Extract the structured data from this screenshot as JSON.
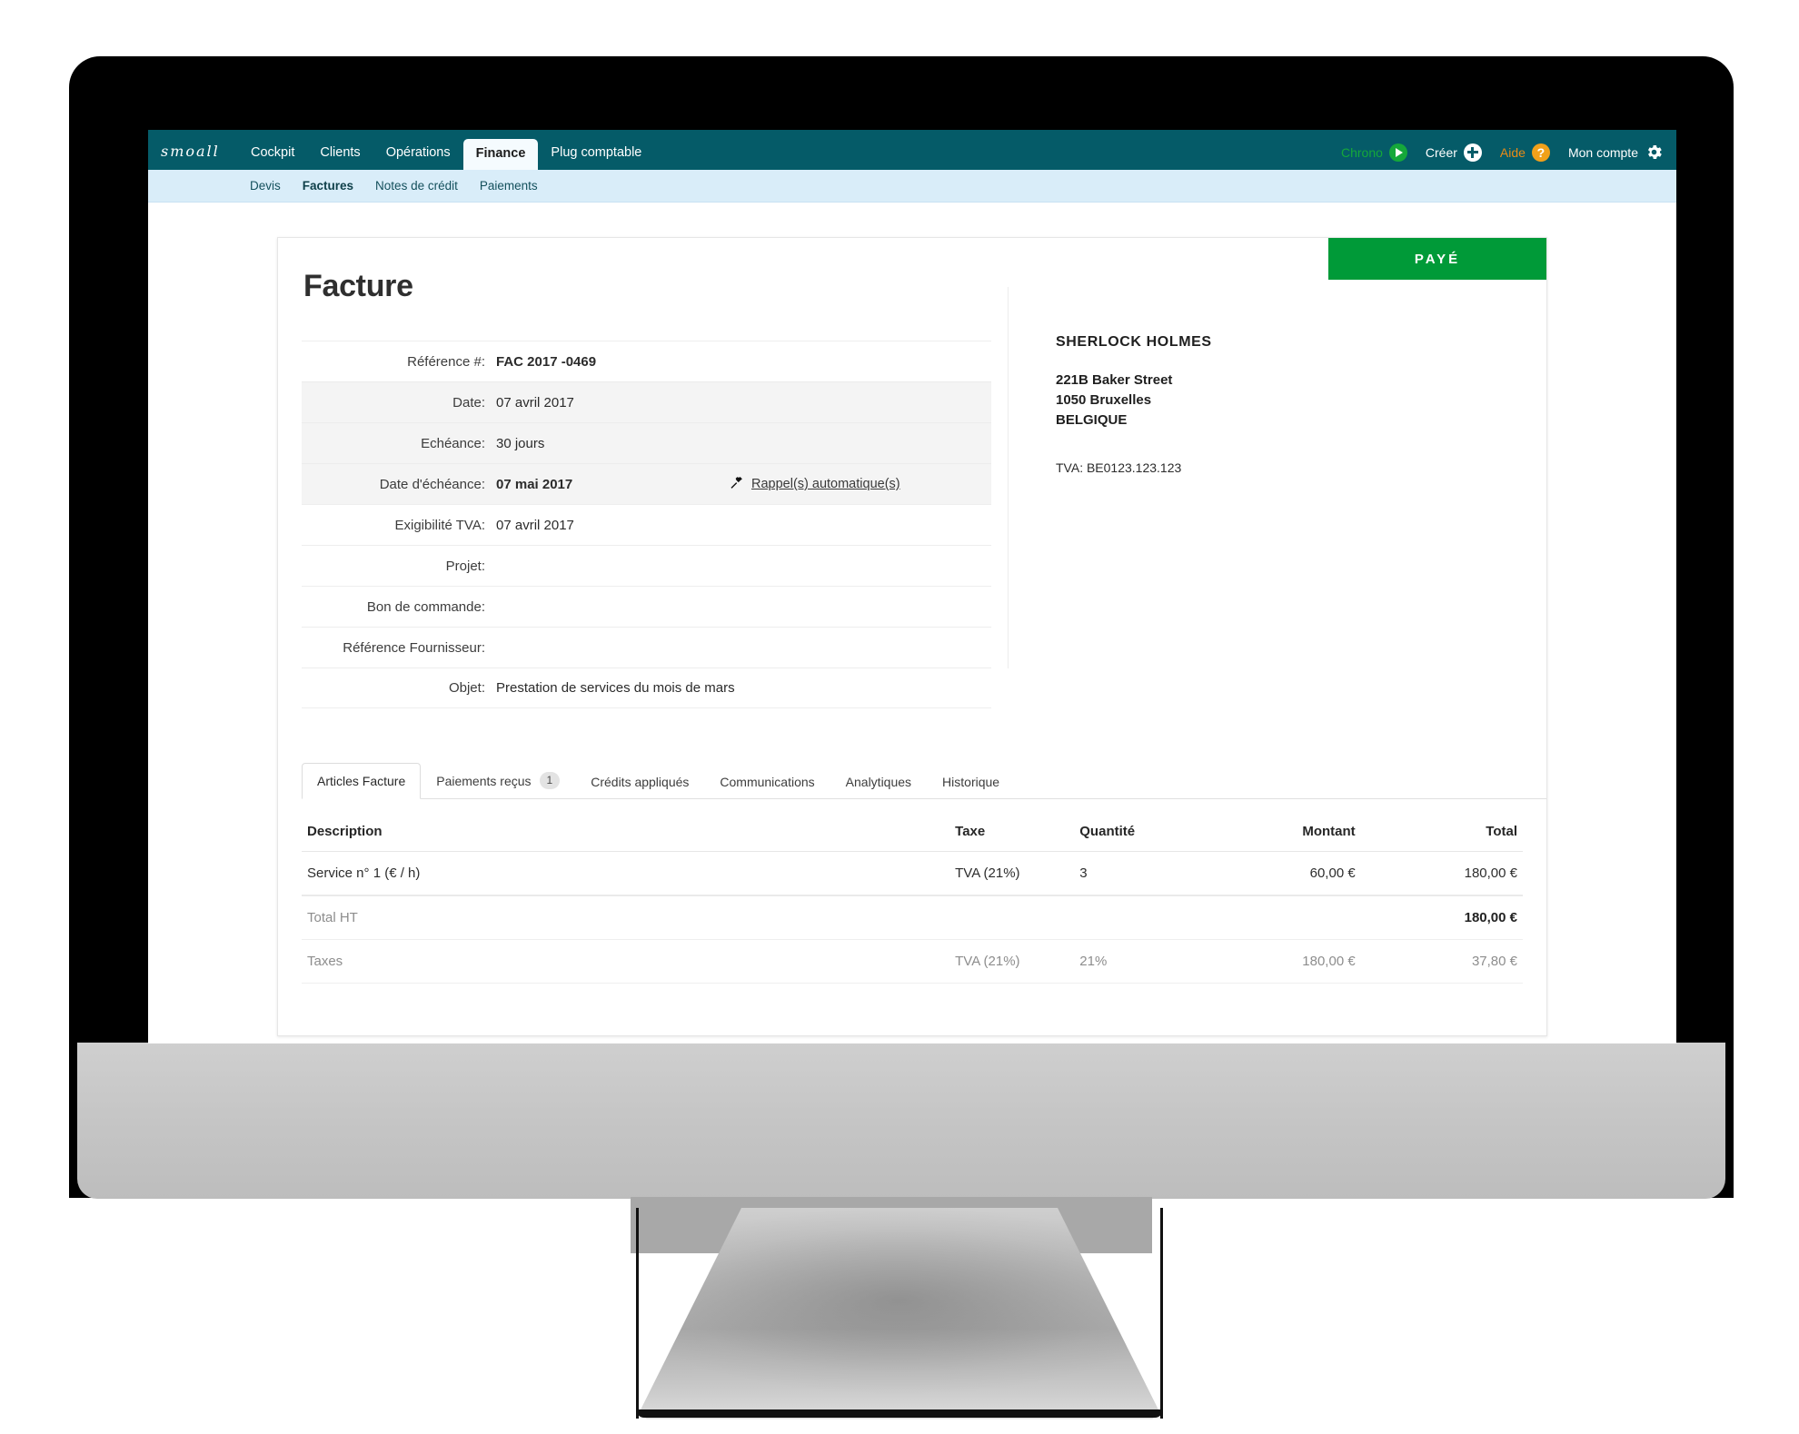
{
  "brand": {
    "logo_text": "smoall",
    "teal": "#055b68",
    "green": "#009a38",
    "orange": "#f1a11a"
  },
  "topnav": {
    "items": [
      {
        "label": "Cockpit",
        "active": false
      },
      {
        "label": "Clients",
        "active": false
      },
      {
        "label": "Opérations",
        "active": false
      },
      {
        "label": "Finance",
        "active": true
      },
      {
        "label": "Plug comptable",
        "active": false
      }
    ],
    "right": [
      {
        "label": "Chrono",
        "icon": "play-circle-icon"
      },
      {
        "label": "Créer",
        "icon": "plus-circle-icon"
      },
      {
        "label": "Aide",
        "icon": "help-circle-icon"
      },
      {
        "label": "Mon compte",
        "icon": "gear-icon"
      }
    ]
  },
  "subnav": {
    "items": [
      {
        "label": "Devis",
        "active": false
      },
      {
        "label": "Factures",
        "active": true
      },
      {
        "label": "Notes de crédit",
        "active": false
      },
      {
        "label": "Paiements",
        "active": false
      }
    ]
  },
  "invoice": {
    "title": "Facture",
    "status_badge": "PAYÉ",
    "details": [
      {
        "label": "Référence #:",
        "value": "FAC 2017 -0469",
        "bold": true,
        "shaded": false
      },
      {
        "label": "Date:",
        "value": "07 avril 2017",
        "bold": false,
        "shaded": true
      },
      {
        "label": "Echéance:",
        "value": "30 jours",
        "bold": false,
        "shaded": true
      },
      {
        "label": "Date d'échéance:",
        "value": "07 mai 2017",
        "bold": true,
        "shaded": true,
        "link": "Rappel(s) automatique(s)",
        "link_icon": "hammer-icon"
      },
      {
        "label": "Exigibilité TVA:",
        "value": "07 avril 2017",
        "bold": false,
        "shaded": false
      },
      {
        "label": "Projet:",
        "value": "",
        "bold": false,
        "shaded": false
      },
      {
        "label": "Bon de commande:",
        "value": "",
        "bold": false,
        "shaded": false
      },
      {
        "label": "Référence Fournisseur:",
        "value": "",
        "bold": false,
        "shaded": false
      },
      {
        "label": "Objet:",
        "value": "Prestation de services du mois de mars",
        "bold": false,
        "shaded": false
      }
    ],
    "customer": {
      "name": "SHERLOCK HOLMES",
      "address_line1": "221B Baker Street",
      "address_line2": "1050 Bruxelles",
      "address_line3": "BELGIQUE",
      "vat": "TVA: BE0123.123.123"
    }
  },
  "tabs": [
    {
      "label": "Articles Facture",
      "badge": "",
      "active": true
    },
    {
      "label": "Paiements reçus",
      "badge": "1",
      "active": false
    },
    {
      "label": "Crédits appliqués",
      "badge": "",
      "active": false
    },
    {
      "label": "Communications",
      "badge": "",
      "active": false
    },
    {
      "label": "Analytiques",
      "badge": "",
      "active": false
    },
    {
      "label": "Historique",
      "badge": "",
      "active": false
    }
  ],
  "items_table": {
    "headers": {
      "description": "Description",
      "taxe": "Taxe",
      "quantite": "Quantité",
      "montant": "Montant",
      "total": "Total"
    },
    "rows": [
      {
        "description": "Service n° 1 (€ / h)",
        "taxe": "TVA (21%)",
        "quantite": "3",
        "montant": "60,00 €",
        "total": "180,00 €"
      }
    ],
    "summary": [
      {
        "description": "Total HT",
        "taxe": "",
        "quantite": "",
        "montant": "",
        "total": "180,00 €",
        "total_strong": true
      },
      {
        "description": "Taxes",
        "taxe": "TVA (21%)",
        "quantite": "21%",
        "montant": "180,00 €",
        "total": "37,80 €",
        "total_strong": false
      }
    ]
  }
}
